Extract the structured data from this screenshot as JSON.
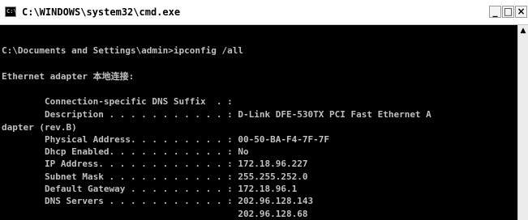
{
  "window": {
    "title": "C:\\WINDOWS\\system32\\cmd.exe",
    "icon_label": "C:\\",
    "icon": "cmd-console-icon",
    "minimize_symbol": "_",
    "maximize_symbol": "□",
    "close_symbol": "×"
  },
  "console": {
    "lines": [
      "C:\\Documents and Settings\\admin>ipconfig /all",
      "Ethernet adapter 本地连接:",
      "        Connection-specific DNS Suffix  . :",
      "        Description . . . . . . . . . . . : D-Link DFE-530TX PCI Fast Ethernet A",
      "dapter (rev.B)",
      "        Physical Address. . . . . . . . . : 00-50-BA-F4-7F-7F",
      "        Dhcp Enabled. . . . . . . . . . . : No",
      "        IP Address. . . . . . . . . . . . : 172.18.96.227",
      "        Subnet Mask . . . . . . . . . . . : 255.255.252.0",
      "        Default Gateway . . . . . . . . . : 172.18.96.1",
      "        DNS Servers . . . . . . . . . . . : 202.96.128.143",
      "                                            202.96.128.68"
    ]
  },
  "scrollbar": {
    "up_arrow": "▲"
  },
  "colors": {
    "console_bg": "#000000",
    "console_text": "#c0c0c0",
    "titlebar_bg": "#ffffff"
  }
}
